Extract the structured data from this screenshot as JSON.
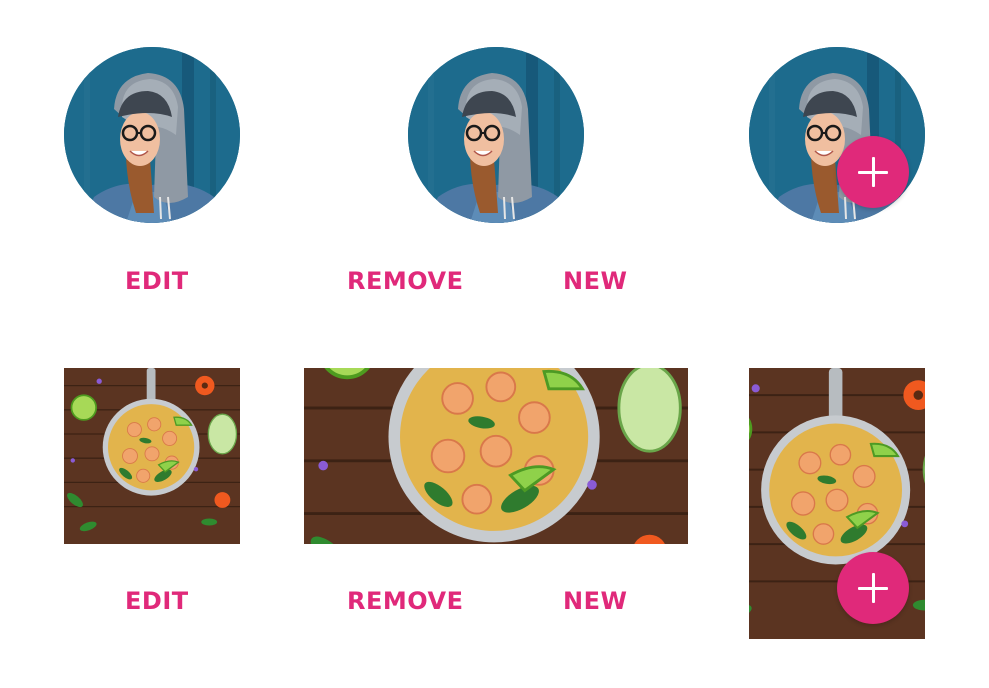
{
  "colors": {
    "accent": "#e0297a",
    "avatar_background": "#1f6f92",
    "photo_background": "#5a3320"
  },
  "avatar_row": {
    "actions": {
      "edit_label": "EDIT",
      "remove_label": "REMOVE",
      "new_label": "NEW"
    },
    "fab_icon": "plus-icon"
  },
  "photo_row": {
    "actions": {
      "edit_label": "EDIT",
      "remove_label": "REMOVE",
      "new_label": "NEW"
    },
    "fab_icon": "plus-icon"
  }
}
